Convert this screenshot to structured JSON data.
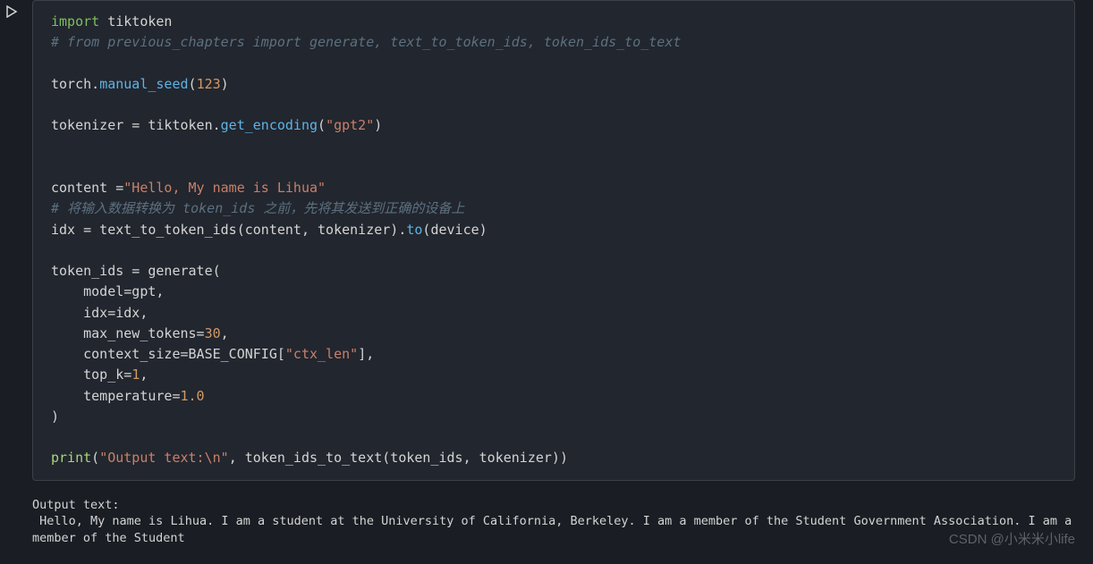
{
  "gutter": {
    "run_icon": "play-icon"
  },
  "code": {
    "l1_kw": "import",
    "l1_mod": " tiktoken",
    "l2_cm": "# from previous_chapters import generate, text_to_token_ids, token_ids_to_text",
    "l3": "",
    "l4_a": "torch.",
    "l4_fn": "manual_seed",
    "l4_b": "(",
    "l4_num": "123",
    "l4_c": ")",
    "l5": "",
    "l6_a": "tokenizer = tiktoken.",
    "l6_fn": "get_encoding",
    "l6_b": "(",
    "l6_str": "\"gpt2\"",
    "l6_c": ")",
    "l7": "",
    "l8": "",
    "l9_a": "content =",
    "l9_str": "\"Hello, My name is Lihua\"",
    "l10_cm": "# 将输入数据转换为 token_ids 之前，先将其发送到正确的设备上",
    "l11_a": "idx = text_to_token_ids(content, tokenizer).",
    "l11_fn": "to",
    "l11_b": "(device)",
    "l12": "",
    "l13_a": "token_ids = generate(",
    "l14_a": "    model=gpt,",
    "l15_a": "    idx=idx,",
    "l16_a": "    max_new_tokens=",
    "l16_num": "30",
    "l16_b": ",",
    "l17_a": "    context_size=BASE_CONFIG[",
    "l17_str": "\"ctx_len\"",
    "l17_b": "],",
    "l18_a": "    top_k=",
    "l18_num": "1",
    "l18_b": ",",
    "l19_a": "    temperature=",
    "l19_num": "1.0",
    "l20_a": ")",
    "l21": "",
    "l22_pr": "print",
    "l22_a": "(",
    "l22_str": "\"Output text:\\n\"",
    "l22_b": ", token_ids_to_text(token_ids, tokenizer))"
  },
  "output": {
    "line1": "Output text:",
    "line2": " Hello, My name is Lihua. I am a student at the University of California, Berkeley. I am a member of the Student Government Association. I am a member of the Student"
  },
  "watermark": "CSDN @小米米小life"
}
